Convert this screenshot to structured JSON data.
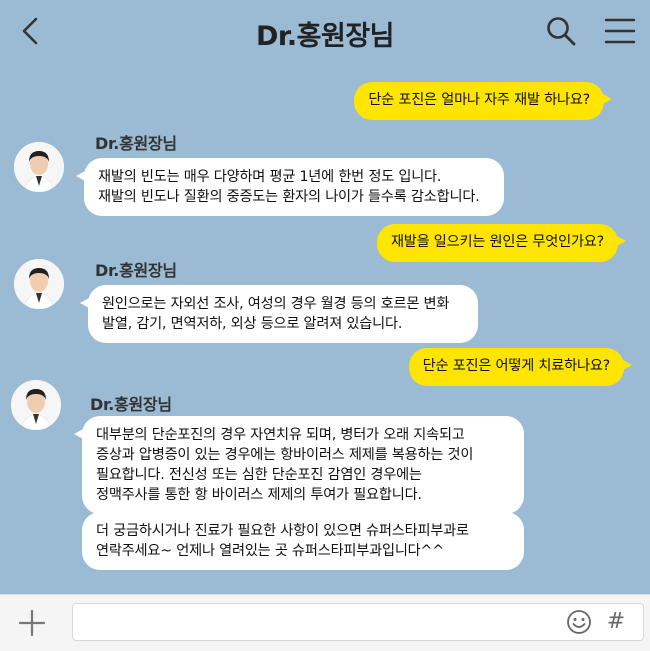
{
  "header": {
    "title": "Dr.홍원장님",
    "background": "#9bbbd4"
  },
  "colors": {
    "my_bubble": "#fee500",
    "their_bubble": "#ffffff",
    "chat_background": "#9bbbd4"
  },
  "icons": {
    "back": "chevron-left-icon",
    "search": "search-icon",
    "menu": "hamburger-menu-icon",
    "plus": "plus-icon",
    "emoji": "emoji-icon",
    "hash": "hash-icon"
  },
  "messages": [
    {
      "from": "me",
      "text": "단순 포진은 얼마나 자주 재발 하나요?"
    },
    {
      "from": "doctor",
      "sender": "Dr.홍원장님",
      "lines": [
        "재발의 빈도는 매우 다양하며 평균 1년에 한번 정도 입니다.",
        "재발의 빈도나 질환의 중증도는 환자의 나이가 들수록 감소합니다."
      ]
    },
    {
      "from": "me",
      "text": "재발을 일으키는 원인은 무엇인가요?"
    },
    {
      "from": "doctor",
      "sender": "Dr.홍원장님",
      "lines": [
        "원인으로는 자외선 조사, 여성의 경우 월경 등의 호르몬 변화",
        "발열, 감기, 면역저하, 외상 등으로 알려져 있습니다."
      ]
    },
    {
      "from": "me",
      "text": "단순 포진은 어떻게 치료하나요?"
    },
    {
      "from": "doctor",
      "sender": "Dr.홍원장님",
      "lines": [
        "대부분의 단순포진의 경우 자연치유 되며, 병터가 오래 지속되고",
        "증상과 압병증이 있는 경우에는 항바이러스 제제를 복용하는 것이",
        "필요합니다. 전신성 또는 심한 단순포진 감염인 경우에는",
        "정맥주사를 통한 항 바이러스 제제의 투여가 필요합니다."
      ]
    },
    {
      "from": "doctor",
      "lines": [
        "더 궁금하시거나 진료가 필요한 사항이 있으면 슈퍼스타피부과로",
        "연락주세요~ 언제나 열려있는 곳 슈퍼스타피부과입니다^^"
      ]
    }
  ],
  "input": {
    "value": "",
    "placeholder": ""
  },
  "hash_symbol": "#"
}
